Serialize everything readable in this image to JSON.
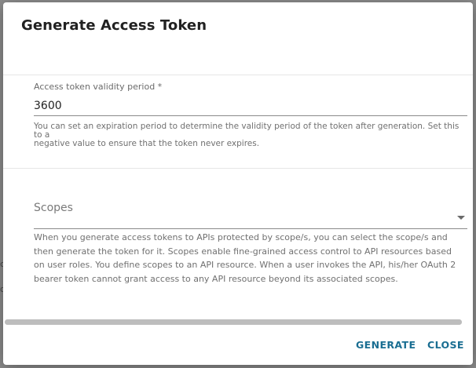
{
  "background": {
    "ghost_glyphs": [
      "c",
      "o"
    ]
  },
  "dialog": {
    "title": "Generate Access Token",
    "validity": {
      "label": "Access token validity period *",
      "value": "3600",
      "helper_line1": "You can set an expiration period to determine the validity period of the token after generation. Set this to a",
      "helper_line2": "negative value to ensure that the token never expires."
    },
    "scopes": {
      "label": "Scopes",
      "helper": "When you generate access tokens to APIs protected by scope/s, you can select the scope/s and then generate the token for it. Scopes enable fine-grained access control to API resources based on user roles. You define scopes to an API resource. When a user invokes the API, his/her OAuth 2 bearer token cannot grant access to any API resource beyond its associated scopes."
    },
    "actions": {
      "generate_label": "GENERATE",
      "close_label": "CLOSE"
    }
  },
  "colors": {
    "accent": "#1a6e92",
    "title": "#212121",
    "helper_text": "#707070",
    "backdrop": "#8c8c8c"
  },
  "icons": {
    "scopes_dropdown": "caret-down-icon"
  }
}
